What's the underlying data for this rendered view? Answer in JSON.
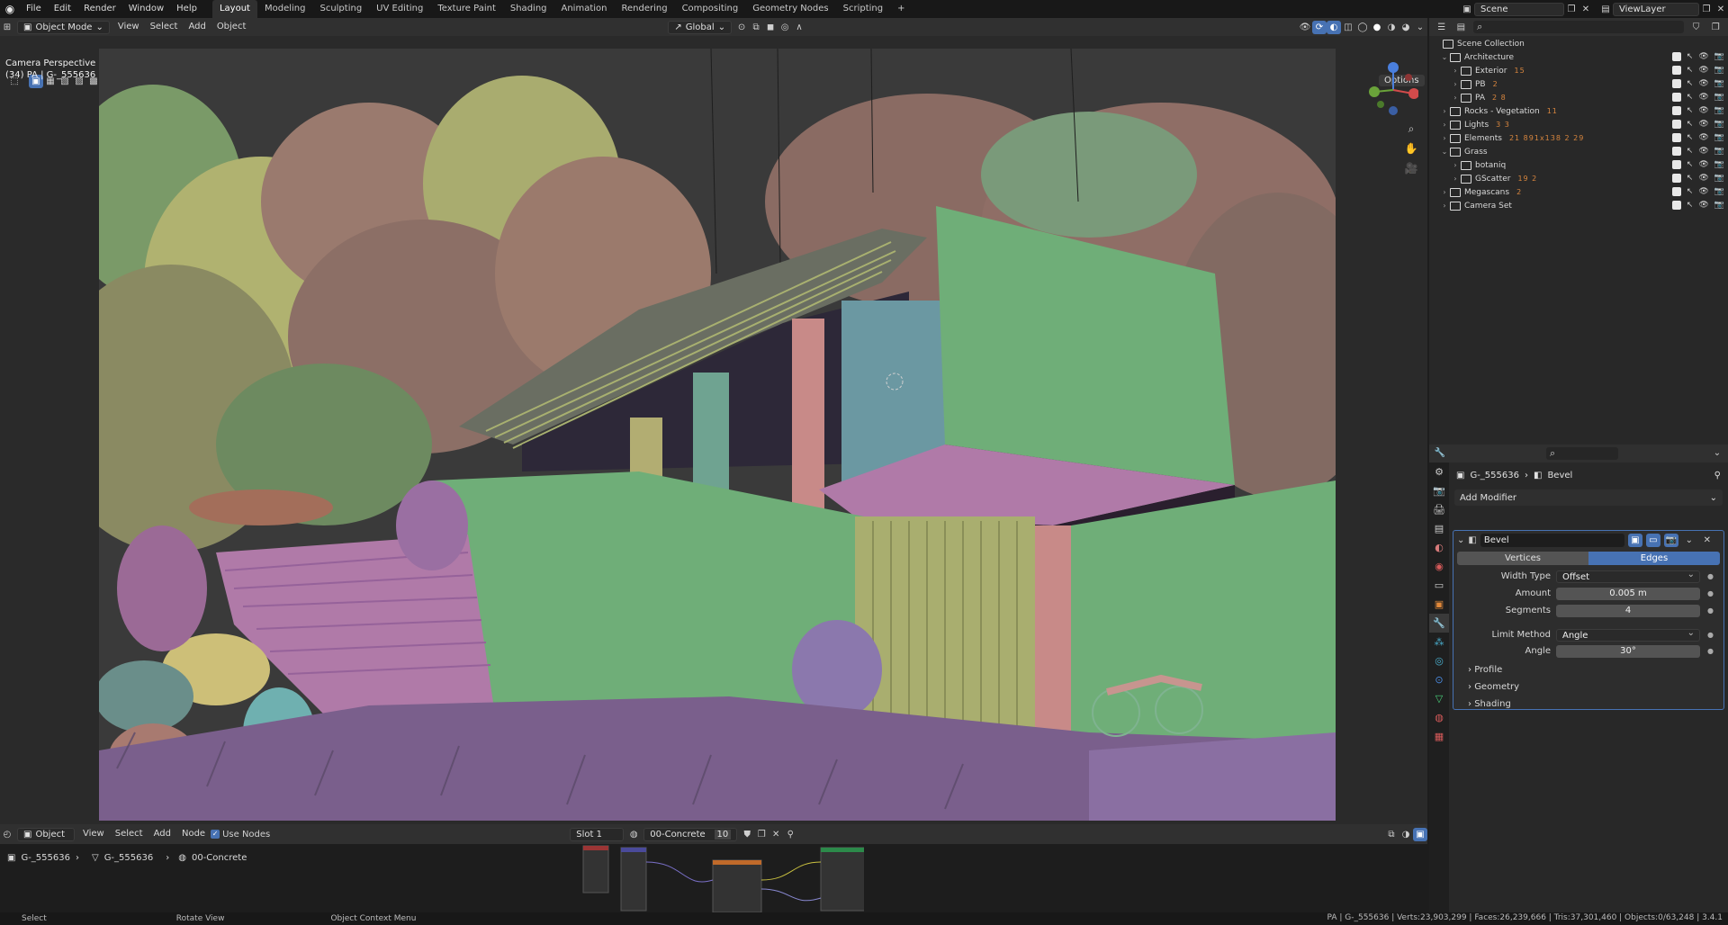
{
  "topbar": {
    "menus": [
      "File",
      "Edit",
      "Render",
      "Window",
      "Help"
    ],
    "workspaces": [
      "Layout",
      "Modeling",
      "Sculpting",
      "UV Editing",
      "Texture Paint",
      "Shading",
      "Animation",
      "Rendering",
      "Compositing",
      "Geometry Nodes",
      "Scripting"
    ],
    "active_workspace": "Layout",
    "add_tab": "+",
    "scene_name": "Scene",
    "view_layer": "ViewLayer"
  },
  "viewport_header": {
    "mode": "Object Mode",
    "menus": [
      "View",
      "Select",
      "Add",
      "Object"
    ],
    "orientation": "Global",
    "options": "Options"
  },
  "viewport": {
    "camera_label": "Camera Perspective",
    "object_label": "(34) PA | G-_555636"
  },
  "node_editor": {
    "type": "Object",
    "menus": [
      "View",
      "Select",
      "Add",
      "Node"
    ],
    "use_nodes": "Use Nodes",
    "slot": "Slot 1",
    "material": "00-Concrete",
    "users": "10",
    "breadcrumb": [
      "G-_555636",
      "G-_555636",
      "00-Concrete"
    ]
  },
  "outliner": {
    "root": "Scene Collection",
    "rows": [
      {
        "label": "Architecture",
        "depth": 1,
        "expanded": true,
        "extra": ""
      },
      {
        "label": "Exterior",
        "depth": 2,
        "expanded": false,
        "extra": "15"
      },
      {
        "label": "PB",
        "depth": 2,
        "expanded": false,
        "extra": "2"
      },
      {
        "label": "PA",
        "depth": 2,
        "expanded": false,
        "extra": "2 8"
      },
      {
        "label": "Rocks - Vegetation",
        "depth": 1,
        "expanded": false,
        "extra": "11"
      },
      {
        "label": "Lights",
        "depth": 1,
        "expanded": false,
        "extra": "3 3"
      },
      {
        "label": "Elements",
        "depth": 1,
        "expanded": false,
        "extra": "21 891x138 2 29"
      },
      {
        "label": "Grass",
        "depth": 1,
        "expanded": true,
        "extra": ""
      },
      {
        "label": "botaniq",
        "depth": 2,
        "expanded": false,
        "extra": ""
      },
      {
        "label": "GScatter",
        "depth": 2,
        "expanded": false,
        "extra": "19 2"
      },
      {
        "label": "Megascans",
        "depth": 1,
        "expanded": false,
        "extra": "2"
      },
      {
        "label": "Camera Set",
        "depth": 1,
        "expanded": false,
        "extra": ""
      }
    ]
  },
  "properties": {
    "object": "G-_555636",
    "modifier_crumb": "Bevel",
    "add_modifier": "Add Modifier",
    "modifier_name": "Bevel",
    "affect_options": [
      "Vertices",
      "Edges"
    ],
    "affect_selected": "Edges",
    "fields": {
      "width_type_label": "Width Type",
      "width_type": "Offset",
      "amount_label": "Amount",
      "amount": "0.005 m",
      "segments_label": "Segments",
      "segments": "4",
      "limit_method_label": "Limit Method",
      "limit_method": "Angle",
      "angle_label": "Angle",
      "angle": "30°"
    },
    "subpanels": [
      "Profile",
      "Geometry",
      "Shading"
    ]
  },
  "statusbar": {
    "select": "Select",
    "rotate": "Rotate View",
    "context": "Object Context Menu",
    "stats": "PA | G-_555636 | Verts:23,903,299 | Faces:26,239,666 | Tris:37,301,460 | Objects:0/63,248 | 3.4.1"
  },
  "colors": {
    "accent": "#4772b3",
    "house_green": "#72a87a",
    "stairs_pink": "#b07aa8",
    "foliage_olive": "#a4a56a",
    "foliage_rose": "#9a7468",
    "ground_purple": "#7a5f8c"
  }
}
